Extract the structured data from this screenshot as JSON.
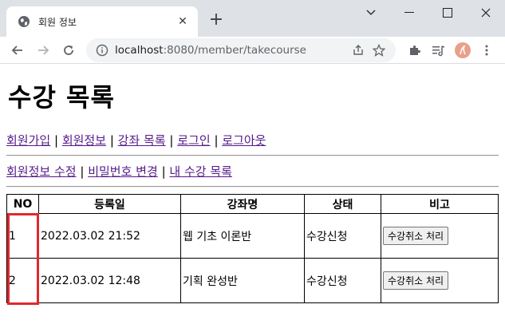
{
  "browser": {
    "tab_title": "회원 정보",
    "url_host": "localhost",
    "url_rest": ":8080/member/takecourse"
  },
  "page": {
    "title": "수강 목록",
    "nav1": [
      {
        "label": "회원가입"
      },
      {
        "label": "회원정보"
      },
      {
        "label": "강좌 목록"
      },
      {
        "label": "로그인"
      },
      {
        "label": "로그아웃"
      }
    ],
    "nav2": [
      {
        "label": "회원정보 수정"
      },
      {
        "label": "비밀번호 변경"
      },
      {
        "label": "내 수강 목록"
      }
    ],
    "separator": "|",
    "table": {
      "headers": [
        "NO",
        "등록일",
        "강좌명",
        "상태",
        "비고"
      ],
      "rows": [
        {
          "no": "1",
          "date": "2022.03.02 21:52",
          "course": "웹 기초 이론반",
          "status": "수강신청",
          "action": "수강취소 처리"
        },
        {
          "no": "2",
          "date": "2022.03.02 12:48",
          "course": "기획 완성반",
          "status": "수강신청",
          "action": "수강취소 처리"
        }
      ]
    }
  },
  "colors": {
    "highlight": "#e0282e",
    "visited_link": "#551a8b",
    "chrome_bg": "#dee1e6"
  },
  "icons": {
    "favicon": "globe-icon",
    "close": "close-icon",
    "new_tab": "plus-icon",
    "back": "back-arrow-icon",
    "forward": "forward-arrow-icon",
    "reload": "reload-icon",
    "info": "info-icon",
    "share": "share-icon",
    "bookmark": "star-icon",
    "extensions": "puzzle-icon",
    "media": "media-queue-icon",
    "profile": "avatar",
    "menu": "kebab-menu-icon"
  }
}
